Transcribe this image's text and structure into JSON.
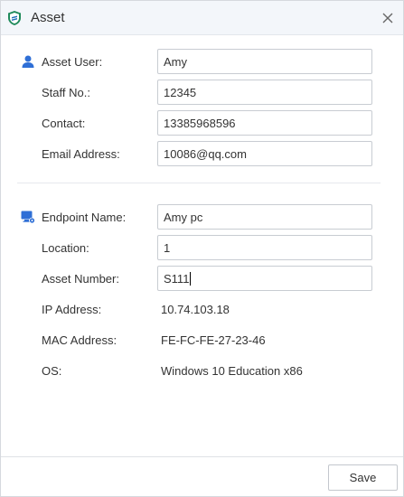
{
  "window": {
    "title": "Asset",
    "logo_icon": "shield-logo-icon",
    "close_icon": "close-icon"
  },
  "user_section": {
    "icon": "person-icon",
    "fields": [
      {
        "label": "Asset User:",
        "value": "Amy"
      },
      {
        "label": "Staff No.:",
        "value": "12345"
      },
      {
        "label": "Contact:",
        "value": "13385968596"
      },
      {
        "label": "Email Address:",
        "value": "10086@qq.com"
      }
    ]
  },
  "endpoint_section": {
    "icon": "computer-gear-icon",
    "endpoint_name": {
      "label": "Endpoint Name:",
      "value": "Amy pc"
    },
    "location": {
      "label": "Location:",
      "value": "1"
    },
    "asset_number": {
      "label": "Asset Number:",
      "value": "S111"
    },
    "ip_address": {
      "label": "IP Address:",
      "value": "10.74.103.18"
    },
    "mac_address": {
      "label": "MAC Address:",
      "value": "FE-FC-FE-27-23-46"
    },
    "os": {
      "label": "OS:",
      "value": "Windows 10 Education x86"
    }
  },
  "footer": {
    "save_label": "Save"
  },
  "colors": {
    "accent": "#2f6fd6",
    "title_bg": "#f3f6fa",
    "border": "#c8ccd2",
    "text": "#333333"
  }
}
